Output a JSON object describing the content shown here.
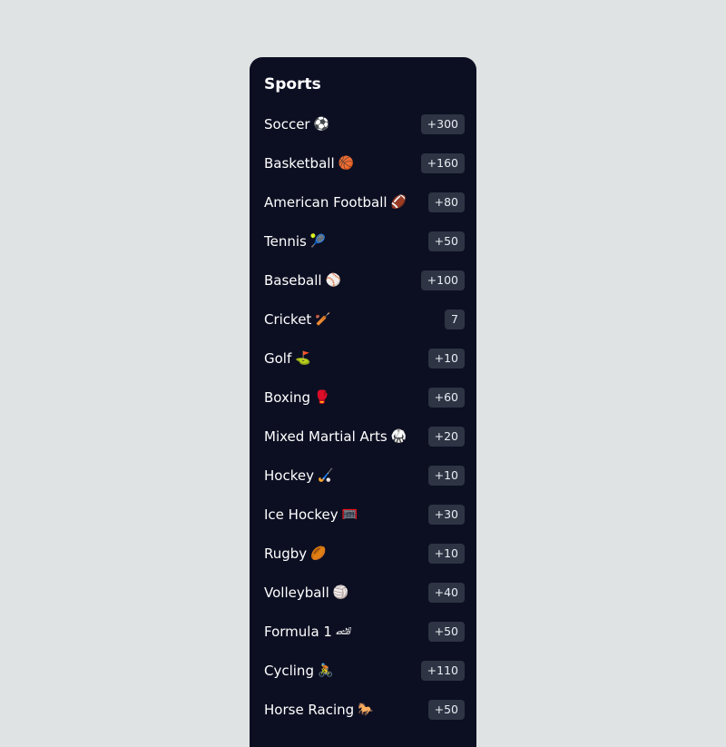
{
  "sidebar": {
    "title": "Sports",
    "items": [
      {
        "label": "Soccer",
        "icon": "⚽",
        "icon_name": "soccer-ball-icon",
        "count": "+300"
      },
      {
        "label": "Basketball",
        "icon": "🏀",
        "icon_name": "basketball-icon",
        "count": "+160"
      },
      {
        "label": "American Football",
        "icon": "🏈",
        "icon_name": "american-football-icon",
        "count": "+80"
      },
      {
        "label": "Tennis",
        "icon": "🎾",
        "icon_name": "tennis-ball-icon",
        "count": "+50"
      },
      {
        "label": "Baseball",
        "icon": "⚾",
        "icon_name": "baseball-icon",
        "count": "+100"
      },
      {
        "label": "Cricket",
        "icon": "🏏",
        "icon_name": "cricket-bat-icon",
        "count": "7"
      },
      {
        "label": "Golf",
        "icon": "⛳",
        "icon_name": "golf-flag-icon",
        "count": "+10"
      },
      {
        "label": "Boxing",
        "icon": "🥊",
        "icon_name": "boxing-glove-icon",
        "count": "+60"
      },
      {
        "label": "Mixed Martial Arts",
        "icon": "🥋",
        "icon_name": "martial-arts-icon",
        "count": "+20"
      },
      {
        "label": "Hockey",
        "icon": "🏑",
        "icon_name": "hockey-stick-icon",
        "count": "+10"
      },
      {
        "label": "Ice Hockey",
        "icon": "🥅",
        "icon_name": "goal-net-icon",
        "count": "+30"
      },
      {
        "label": "Rugby",
        "icon": "🏉",
        "icon_name": "rugby-ball-icon",
        "count": "+10"
      },
      {
        "label": "Volleyball",
        "icon": "🏐",
        "icon_name": "volleyball-icon",
        "count": "+40"
      },
      {
        "label": "Formula 1",
        "icon": "🏎",
        "icon_name": "race-car-icon",
        "count": "+50"
      },
      {
        "label": "Cycling",
        "icon": "🚴",
        "icon_name": "cyclist-icon",
        "count": "+110"
      },
      {
        "label": "Horse Racing",
        "icon": "🐎",
        "icon_name": "horse-icon",
        "count": "+50"
      }
    ]
  }
}
